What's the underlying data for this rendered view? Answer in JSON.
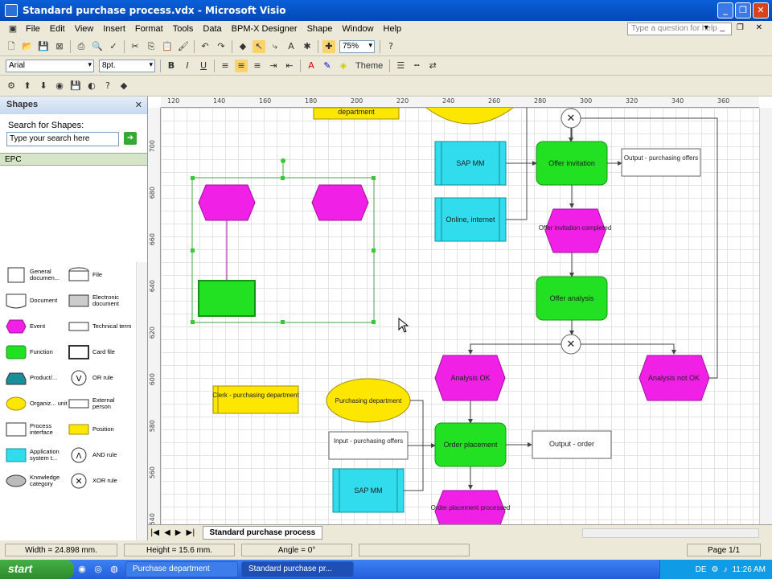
{
  "window": {
    "title": "Standard purchase process.vdx - Microsoft Visio"
  },
  "menu": {
    "items": [
      "File",
      "Edit",
      "View",
      "Insert",
      "Format",
      "Tools",
      "Data",
      "BPM-X Designer",
      "Shape",
      "Window",
      "Help"
    ],
    "ask_placeholder": "Type a question for help"
  },
  "toolbar": {
    "zoom": "75%",
    "font": "Arial",
    "font_size": "8pt.",
    "theme_label": "Theme"
  },
  "shapes_panel": {
    "title": "Shapes",
    "search_label": "Search for Shapes:",
    "search_placeholder": "Type your search here",
    "stencil": "EPC",
    "items": [
      "General documen...",
      "File",
      "Document",
      "Electronic document",
      "Event",
      "Technical term",
      "Function",
      "Card file",
      "Product/...",
      "OR rule",
      "Organiz... unit",
      "External person",
      "Process interface",
      "Position",
      "Application system t...",
      "AND rule",
      "Knowledge category",
      "XOR rule"
    ]
  },
  "rulers": {
    "top": [
      "120",
      "140",
      "160",
      "180",
      "200",
      "220",
      "240",
      "260",
      "280",
      "300",
      "320",
      "340",
      "360"
    ],
    "left": [
      "700",
      "680",
      "660",
      "640",
      "620",
      "600",
      "580",
      "560",
      "540"
    ]
  },
  "diagram": {
    "department_top": "department",
    "sap_mm": "SAP MM",
    "online_internet": "Online, internet",
    "offer_invitation": "Offer invitation",
    "output_purchasing_offers": "Output - purchasing offers",
    "offer_invitation_completed": "Offer invitation completed",
    "offer_analysis": "Offer analysis",
    "analysis_ok": "Analysis OK",
    "analysis_not_ok": "Analysis not OK",
    "clerk": "Clerk - purchasing department",
    "purchasing_department": "Purchasing department",
    "input_purchasing_offers": "Input - purchasing offers",
    "order_placement": "Order placement",
    "output_order": "Output - order",
    "sap_mm_2": "SAP MM",
    "order_placement_processed": "Order placement processed"
  },
  "page_tabs": {
    "tab": "Standard purchase process"
  },
  "status": {
    "width": "Width = 24.898 mm.",
    "height": "Height = 15.6 mm.",
    "angle": "Angle = 0°",
    "page": "Page 1/1"
  },
  "taskbar": {
    "start": "start",
    "tasks": [
      "Purchase department",
      "Standard purchase pr..."
    ],
    "lang": "DE",
    "time": "11:26 AM"
  },
  "colors": {
    "function": "#22e022",
    "event": "#f020e6",
    "system": "#31dcec",
    "org": "#fde700"
  }
}
